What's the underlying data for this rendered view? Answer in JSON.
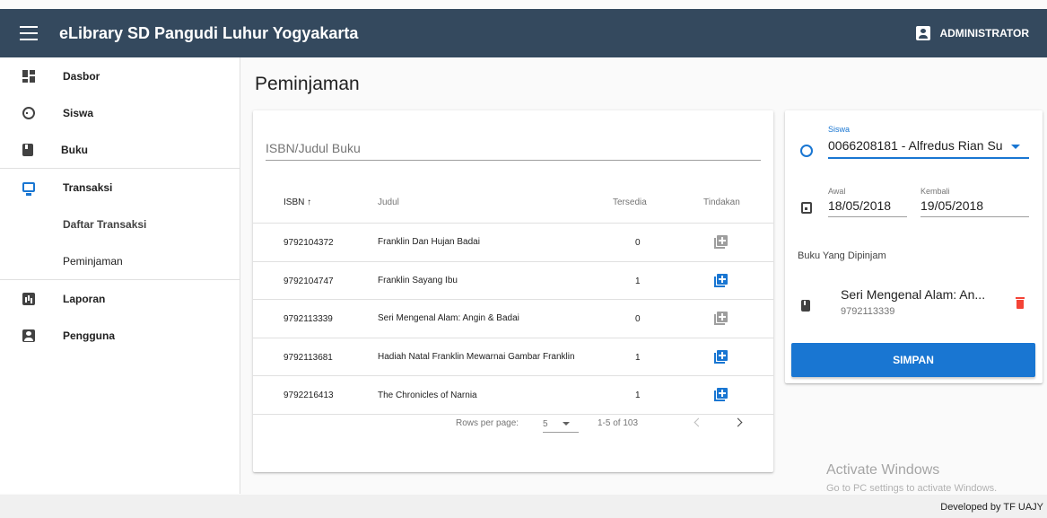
{
  "app": {
    "title": "eLibrary SD Pangudi Luhur Yogyakarta",
    "account_label": "ADMINISTRATOR"
  },
  "sidebar": {
    "items": [
      {
        "label": "Dasbor",
        "icon": "dashboard-icon"
      },
      {
        "label": "Siswa",
        "icon": "face-icon"
      },
      {
        "label": "Buku",
        "icon": "book-icon"
      },
      {
        "label": "Transaksi",
        "icon": "monitor-icon",
        "color": "#1976d2"
      },
      {
        "label": "Daftar Transaksi"
      },
      {
        "label": "Peminjaman"
      },
      {
        "label": "Laporan",
        "icon": "chart-icon"
      },
      {
        "label": "Pengguna",
        "icon": "account-icon"
      }
    ]
  },
  "page": {
    "title": "Peminjaman"
  },
  "search": {
    "placeholder": "ISBN/Judul Buku"
  },
  "table": {
    "headers": {
      "isbn": "ISBN",
      "sort_indicator": "↑",
      "judul": "Judul",
      "tersedia": "Tersedia",
      "tindakan": "Tindakan"
    },
    "rows": [
      {
        "isbn": "9792104372",
        "judul": "Franklin Dan Hujan Badai",
        "tersedia": "0",
        "action_enabled": false
      },
      {
        "isbn": "9792104747",
        "judul": "Franklin Sayang Ibu",
        "tersedia": "1",
        "action_enabled": true
      },
      {
        "isbn": "9792113339",
        "judul": "Seri Mengenal Alam: Angin & Badai",
        "tersedia": "0",
        "action_enabled": false
      },
      {
        "isbn": "9792113681",
        "judul": "Hadiah Natal Franklin Mewarnai Gambar Franklin",
        "tersedia": "1",
        "action_enabled": true
      },
      {
        "isbn": "9792216413",
        "judul": "The Chronicles of Narnia",
        "tersedia": "1",
        "action_enabled": true
      }
    ],
    "footer": {
      "rows_per_page_label": "Rows per page:",
      "rows_per_page_value": "5",
      "range": "1-5 of 103"
    }
  },
  "form": {
    "siswa_label": "Siswa",
    "siswa_value": "0066208181 - Alfredus Rian Su",
    "awal_label": "Awal",
    "awal_value": "18/05/2018",
    "kembali_label": "Kembali",
    "kembali_value": "19/05/2018",
    "borrowed_title": "Buku Yang Dipinjam",
    "borrowed": [
      {
        "title": "Seri Mengenal Alam: An...",
        "isbn": "9792113339"
      }
    ],
    "save_label": "SIMPAN"
  },
  "watermark": {
    "line1": "Activate Windows",
    "line2": "Go to PC settings to activate Windows."
  },
  "footer": {
    "credit": "Developed by TF UAJY"
  },
  "colors": {
    "primary": "#1976d2",
    "topbar": "#34495e",
    "delete": "#f44336",
    "disabled": "#9e9e9e"
  }
}
